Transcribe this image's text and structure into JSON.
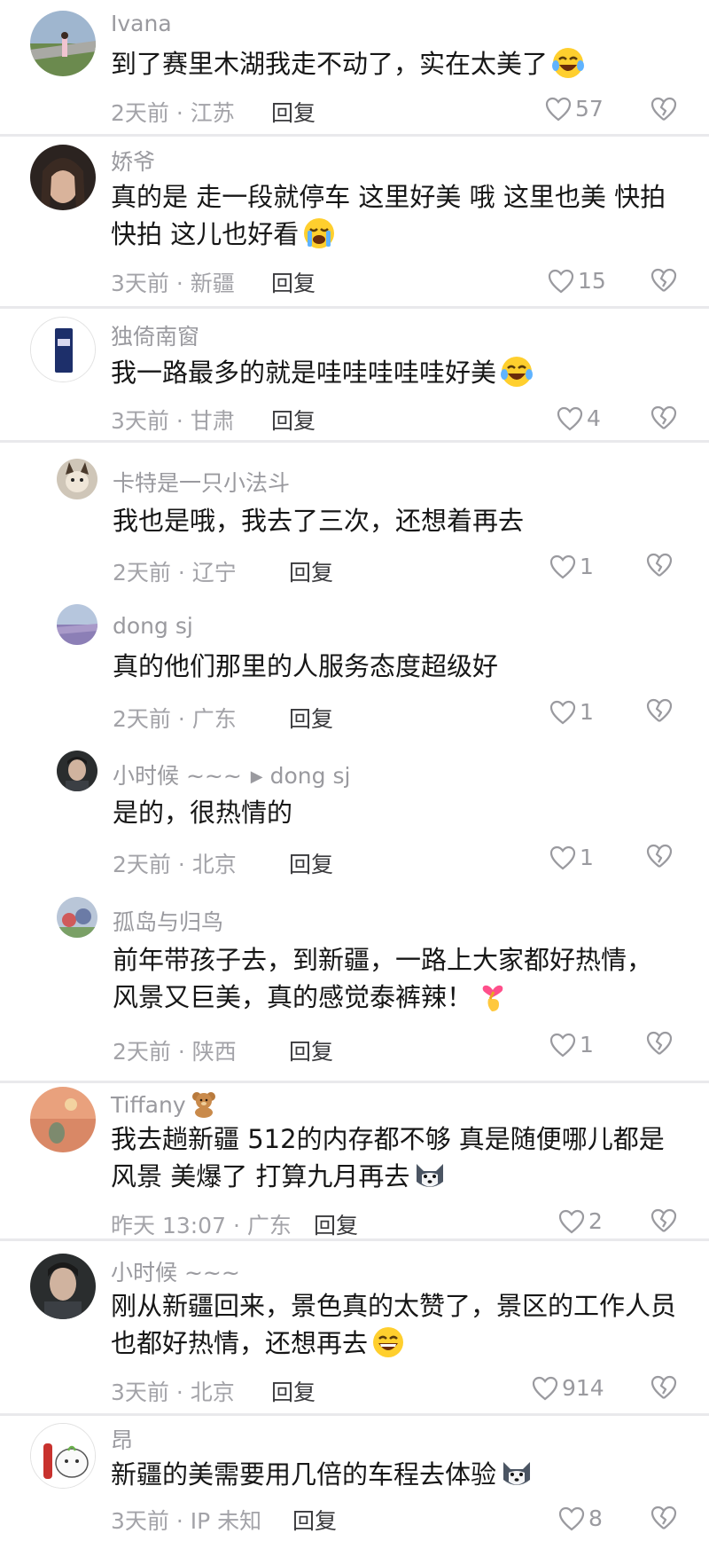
{
  "colors": {
    "background": "#ffffff",
    "separator": "#e9e9ec",
    "name": "#9a9a9f",
    "text": "#161616",
    "meta": "#a3a3a8",
    "reply": "#3a3a3d"
  },
  "comments": [
    {
      "name": "Ivana",
      "text": "到了赛里木湖我走不动了，实在太美了",
      "emoji": "laughing-crying-emoji",
      "meta": "2天前 · 江苏",
      "reply": "回复",
      "likes": "57"
    },
    {
      "name": "娇爷",
      "text": "真的是 走一段就停车 这里好美 哦 这里也美 快拍 快拍 这儿也好看",
      "emoji": "crying-emoji",
      "meta": "3天前 · 新疆",
      "reply": "回复",
      "likes": "15"
    },
    {
      "name": "独倚南窗",
      "text": "我一路最多的就是哇哇哇哇哇好美",
      "emoji": "laughing-crying-emoji",
      "meta": "3天前 · 甘肃",
      "reply": "回复",
      "likes": "4"
    },
    {
      "name": "卡特是一只小法斗",
      "text": "我也是哦，我去了三次，还想着再去",
      "meta": "2天前 · 辽宁",
      "reply": "回复",
      "likes": "1"
    },
    {
      "name": "dong sj",
      "text": "真的他们那里的人服务态度超级好",
      "meta": "2天前 · 广东",
      "reply": "回复",
      "likes": "1"
    },
    {
      "name": "小时候 ~~~",
      "reply_to": "dong sj",
      "text": "是的，很热情的",
      "meta": "2天前 · 北京",
      "reply": "回复",
      "likes": "1"
    },
    {
      "name": "孤岛与归鸟",
      "text": "前年带孩子去，到新疆，一路上大家都好热情，风景又巨美，真的感觉泰裤辣！",
      "emoji": "finger-heart-emoji",
      "meta": "2天前 · 陕西",
      "reply": "回复",
      "likes": "1"
    },
    {
      "name": "Tiffany",
      "name_emoji": "teddy-bear-emoji",
      "text": "我去趟新疆 512的内存都不够 真是随便哪儿都是风景 美爆了 打算九月再去",
      "emoji": "husky-emoji",
      "meta": "昨天 13:07 · 广东",
      "reply": "回复",
      "likes": "2"
    },
    {
      "name": "小时候 ~~~",
      "text": "刚从新疆回来，景色真的太赞了，景区的工作人员也都好热情，还想再去",
      "emoji": "grinning-emoji",
      "meta": "3天前 · 北京",
      "reply": "回复",
      "likes": "914"
    },
    {
      "name": "昂",
      "text": "新疆的美需要用几倍的车程去体验",
      "emoji": "husky-emoji",
      "meta": "3天前 · IP 未知",
      "reply": "回复",
      "likes": "8"
    }
  ]
}
